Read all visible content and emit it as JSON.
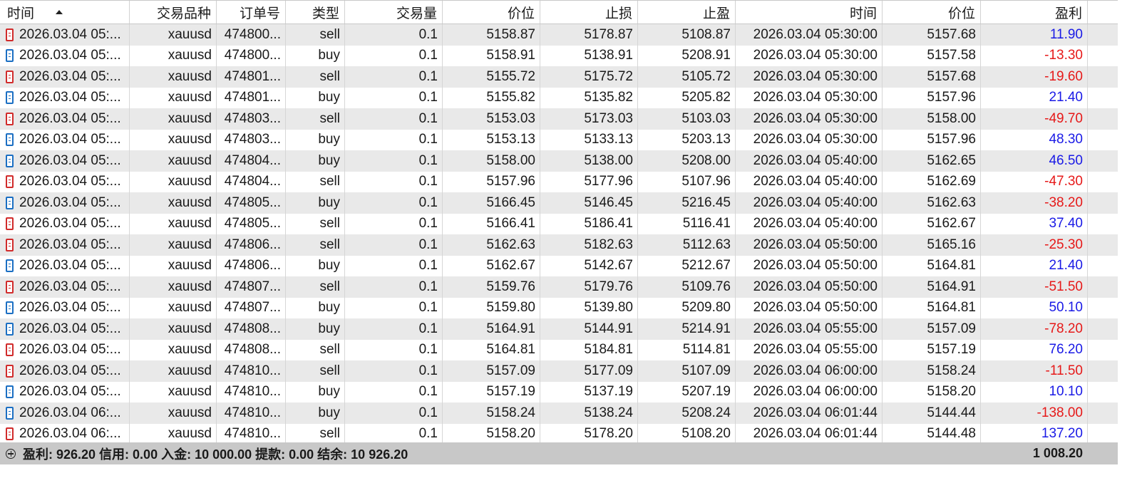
{
  "table": {
    "columns": [
      {
        "key": "open_time",
        "label": "时间"
      },
      {
        "key": "symbol",
        "label": "交易品种"
      },
      {
        "key": "order_id",
        "label": "订单号"
      },
      {
        "key": "type",
        "label": "类型"
      },
      {
        "key": "volume",
        "label": "交易量"
      },
      {
        "key": "open_price",
        "label": "价位"
      },
      {
        "key": "stop_loss",
        "label": "止损"
      },
      {
        "key": "take_profit",
        "label": "止盈"
      },
      {
        "key": "close_time",
        "label": "时间"
      },
      {
        "key": "close_price",
        "label": "价位"
      },
      {
        "key": "profit",
        "label": "盈利"
      }
    ],
    "rows": [
      {
        "open_time": "2026.03.04 05:...",
        "symbol": "xauusd",
        "order_id": "474800...",
        "type": "sell",
        "volume": "0.1",
        "open_price": "5158.87",
        "stop_loss": "5178.87",
        "take_profit": "5108.87",
        "close_time": "2026.03.04 05:30:00",
        "close_price": "5157.68",
        "profit": "11.90"
      },
      {
        "open_time": "2026.03.04 05:...",
        "symbol": "xauusd",
        "order_id": "474800...",
        "type": "buy",
        "volume": "0.1",
        "open_price": "5158.91",
        "stop_loss": "5138.91",
        "take_profit": "5208.91",
        "close_time": "2026.03.04 05:30:00",
        "close_price": "5157.58",
        "profit": "-13.30"
      },
      {
        "open_time": "2026.03.04 05:...",
        "symbol": "xauusd",
        "order_id": "474801...",
        "type": "sell",
        "volume": "0.1",
        "open_price": "5155.72",
        "stop_loss": "5175.72",
        "take_profit": "5105.72",
        "close_time": "2026.03.04 05:30:00",
        "close_price": "5157.68",
        "profit": "-19.60"
      },
      {
        "open_time": "2026.03.04 05:...",
        "symbol": "xauusd",
        "order_id": "474801...",
        "type": "buy",
        "volume": "0.1",
        "open_price": "5155.82",
        "stop_loss": "5135.82",
        "take_profit": "5205.82",
        "close_time": "2026.03.04 05:30:00",
        "close_price": "5157.96",
        "profit": "21.40"
      },
      {
        "open_time": "2026.03.04 05:...",
        "symbol": "xauusd",
        "order_id": "474803...",
        "type": "sell",
        "volume": "0.1",
        "open_price": "5153.03",
        "stop_loss": "5173.03",
        "take_profit": "5103.03",
        "close_time": "2026.03.04 05:30:00",
        "close_price": "5158.00",
        "profit": "-49.70"
      },
      {
        "open_time": "2026.03.04 05:...",
        "symbol": "xauusd",
        "order_id": "474803...",
        "type": "buy",
        "volume": "0.1",
        "open_price": "5153.13",
        "stop_loss": "5133.13",
        "take_profit": "5203.13",
        "close_time": "2026.03.04 05:30:00",
        "close_price": "5157.96",
        "profit": "48.30"
      },
      {
        "open_time": "2026.03.04 05:...",
        "symbol": "xauusd",
        "order_id": "474804...",
        "type": "buy",
        "volume": "0.1",
        "open_price": "5158.00",
        "stop_loss": "5138.00",
        "take_profit": "5208.00",
        "close_time": "2026.03.04 05:40:00",
        "close_price": "5162.65",
        "profit": "46.50"
      },
      {
        "open_time": "2026.03.04 05:...",
        "symbol": "xauusd",
        "order_id": "474804...",
        "type": "sell",
        "volume": "0.1",
        "open_price": "5157.96",
        "stop_loss": "5177.96",
        "take_profit": "5107.96",
        "close_time": "2026.03.04 05:40:00",
        "close_price": "5162.69",
        "profit": "-47.30"
      },
      {
        "open_time": "2026.03.04 05:...",
        "symbol": "xauusd",
        "order_id": "474805...",
        "type": "buy",
        "volume": "0.1",
        "open_price": "5166.45",
        "stop_loss": "5146.45",
        "take_profit": "5216.45",
        "close_time": "2026.03.04 05:40:00",
        "close_price": "5162.63",
        "profit": "-38.20"
      },
      {
        "open_time": "2026.03.04 05:...",
        "symbol": "xauusd",
        "order_id": "474805...",
        "type": "sell",
        "volume": "0.1",
        "open_price": "5166.41",
        "stop_loss": "5186.41",
        "take_profit": "5116.41",
        "close_time": "2026.03.04 05:40:00",
        "close_price": "5162.67",
        "profit": "37.40"
      },
      {
        "open_time": "2026.03.04 05:...",
        "symbol": "xauusd",
        "order_id": "474806...",
        "type": "sell",
        "volume": "0.1",
        "open_price": "5162.63",
        "stop_loss": "5182.63",
        "take_profit": "5112.63",
        "close_time": "2026.03.04 05:50:00",
        "close_price": "5165.16",
        "profit": "-25.30"
      },
      {
        "open_time": "2026.03.04 05:...",
        "symbol": "xauusd",
        "order_id": "474806...",
        "type": "buy",
        "volume": "0.1",
        "open_price": "5162.67",
        "stop_loss": "5142.67",
        "take_profit": "5212.67",
        "close_time": "2026.03.04 05:50:00",
        "close_price": "5164.81",
        "profit": "21.40"
      },
      {
        "open_time": "2026.03.04 05:...",
        "symbol": "xauusd",
        "order_id": "474807...",
        "type": "sell",
        "volume": "0.1",
        "open_price": "5159.76",
        "stop_loss": "5179.76",
        "take_profit": "5109.76",
        "close_time": "2026.03.04 05:50:00",
        "close_price": "5164.91",
        "profit": "-51.50"
      },
      {
        "open_time": "2026.03.04 05:...",
        "symbol": "xauusd",
        "order_id": "474807...",
        "type": "buy",
        "volume": "0.1",
        "open_price": "5159.80",
        "stop_loss": "5139.80",
        "take_profit": "5209.80",
        "close_time": "2026.03.04 05:50:00",
        "close_price": "5164.81",
        "profit": "50.10"
      },
      {
        "open_time": "2026.03.04 05:...",
        "symbol": "xauusd",
        "order_id": "474808...",
        "type": "buy",
        "volume": "0.1",
        "open_price": "5164.91",
        "stop_loss": "5144.91",
        "take_profit": "5214.91",
        "close_time": "2026.03.04 05:55:00",
        "close_price": "5157.09",
        "profit": "-78.20"
      },
      {
        "open_time": "2026.03.04 05:...",
        "symbol": "xauusd",
        "order_id": "474808...",
        "type": "sell",
        "volume": "0.1",
        "open_price": "5164.81",
        "stop_loss": "5184.81",
        "take_profit": "5114.81",
        "close_time": "2026.03.04 05:55:00",
        "close_price": "5157.19",
        "profit": "76.20"
      },
      {
        "open_time": "2026.03.04 05:...",
        "symbol": "xauusd",
        "order_id": "474810...",
        "type": "sell",
        "volume": "0.1",
        "open_price": "5157.09",
        "stop_loss": "5177.09",
        "take_profit": "5107.09",
        "close_time": "2026.03.04 06:00:00",
        "close_price": "5158.24",
        "profit": "-11.50"
      },
      {
        "open_time": "2026.03.04 05:...",
        "symbol": "xauusd",
        "order_id": "474810...",
        "type": "buy",
        "volume": "0.1",
        "open_price": "5157.19",
        "stop_loss": "5137.19",
        "take_profit": "5207.19",
        "close_time": "2026.03.04 06:00:00",
        "close_price": "5158.20",
        "profit": "10.10"
      },
      {
        "open_time": "2026.03.04 06:...",
        "symbol": "xauusd",
        "order_id": "474810...",
        "type": "buy",
        "volume": "0.1",
        "open_price": "5158.24",
        "stop_loss": "5138.24",
        "take_profit": "5208.24",
        "close_time": "2026.03.04 06:01:44",
        "close_price": "5144.44",
        "profit": "-138.00"
      },
      {
        "open_time": "2026.03.04 06:...",
        "symbol": "xauusd",
        "order_id": "474810...",
        "type": "sell",
        "volume": "0.1",
        "open_price": "5158.20",
        "stop_loss": "5178.20",
        "take_profit": "5108.20",
        "close_time": "2026.03.04 06:01:44",
        "close_price": "5144.48",
        "profit": "137.20"
      }
    ]
  },
  "summary": {
    "text": "盈利: 926.20  信用: 0.00  入金: 10 000.00  提款: 0.00  结余: 10 926.20",
    "total": "1 008.20"
  },
  "colors": {
    "profit_positive": "#1a1ae6",
    "profit_negative": "#e61919",
    "sell_icon": "#d12b2b",
    "buy_icon": "#1b6fc3",
    "row_alt": "#e9e9e9",
    "summary_bg": "#c8c8c8"
  },
  "icons": {
    "sort": "sort-ascending-icon",
    "order": "order-document-icon",
    "expand": "expand-plus-icon"
  }
}
